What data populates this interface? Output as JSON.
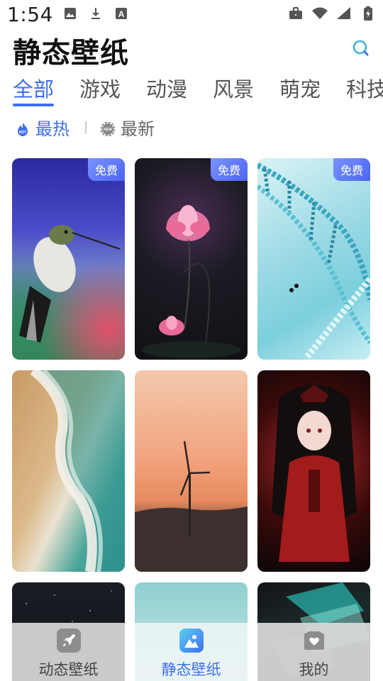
{
  "status_bar": {
    "time": "1:54",
    "left_icons": [
      "image-icon",
      "download-icon",
      "font-a-icon"
    ],
    "right_icons": [
      "briefcase-icon",
      "wifi-icon",
      "signal-icon",
      "battery-charging-icon"
    ]
  },
  "header": {
    "title": "静态壁纸",
    "search_icon": "search-icon"
  },
  "tabs": [
    {
      "label": "全部",
      "active": true
    },
    {
      "label": "游戏",
      "active": false
    },
    {
      "label": "动漫",
      "active": false
    },
    {
      "label": "风景",
      "active": false
    },
    {
      "label": "萌宠",
      "active": false
    },
    {
      "label": "科技",
      "active": false
    }
  ],
  "sort": {
    "hot_label": "最热",
    "hot_icon": "flame-hot-icon",
    "new_label": "最新",
    "new_icon": "gear-new-icon"
  },
  "wallpapers": [
    {
      "subject": "hummingbird",
      "badge": "免费"
    },
    {
      "subject": "lotus-flower",
      "badge": "免费"
    },
    {
      "subject": "dna-helix",
      "badge": "免费"
    },
    {
      "subject": "beach-waves",
      "badge": ""
    },
    {
      "subject": "wind-turbine-sunset",
      "badge": ""
    },
    {
      "subject": "anime-girl-red-dress",
      "badge": ""
    },
    {
      "subject": "starry-dark",
      "badge": ""
    },
    {
      "subject": "teal-gradient",
      "badge": ""
    },
    {
      "subject": "abstract-neon",
      "badge": ""
    }
  ],
  "bottom_nav": [
    {
      "label": "动态壁纸",
      "icon": "rocket-icon",
      "active": false
    },
    {
      "label": "静态壁纸",
      "icon": "picture-icon",
      "active": true
    },
    {
      "label": "我的",
      "icon": "heart-box-icon",
      "active": false
    }
  ],
  "colors": {
    "accent": "#3f6ff0",
    "badge_gradient_start": "#7a92ff",
    "badge_gradient_end": "#4b66f0"
  }
}
